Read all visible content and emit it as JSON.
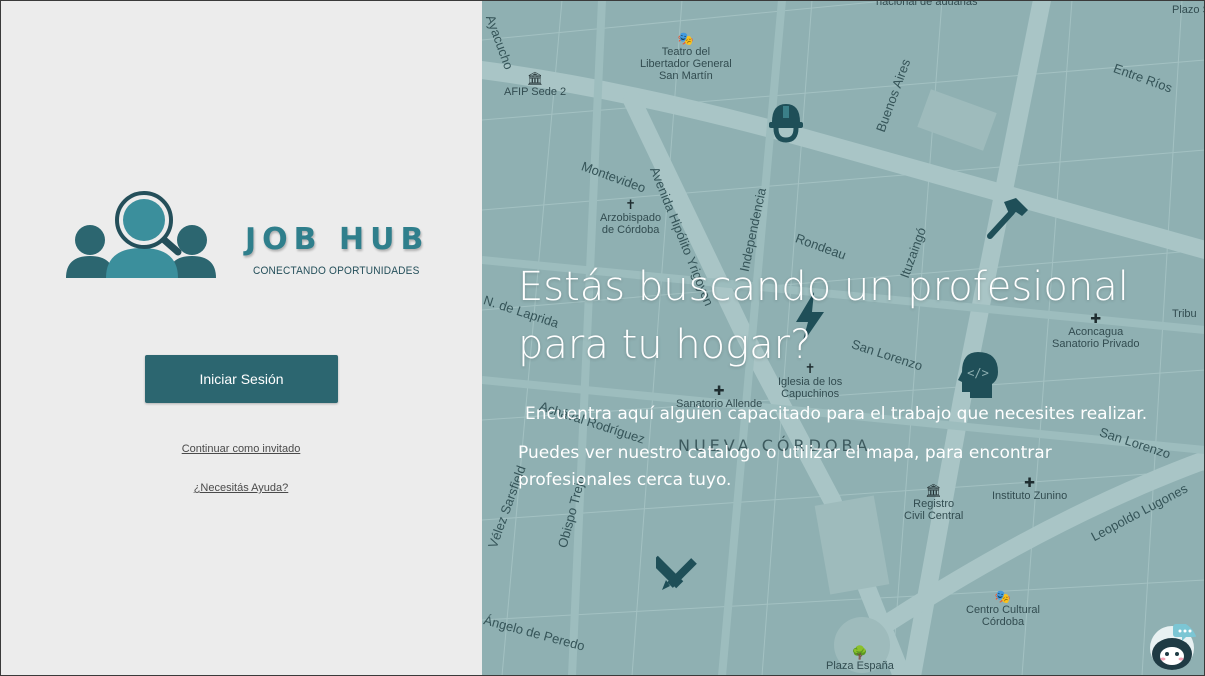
{
  "brand": {
    "title": "JOB HUB",
    "tagline": "CONECTANDO OPORTUNIDADES"
  },
  "auth": {
    "login_label": "Iniciar Sesión",
    "guest_label": "Continuar como invitado",
    "help_label": "¿Necesitás Ayuda?"
  },
  "hero": {
    "headline": "Estás buscando un profesional para tu hogar?",
    "line1": "Encuentra aquí alguien capacitado para el trabajo que necesites realizar.",
    "line2": "Puedes ver nuestro catalogo o utilizar el mapa, para encontrar profesionales cerca tuyo."
  },
  "map": {
    "streets": [
      "Ayacucho",
      "Montevideo",
      "Avenida Hipólito Yrigoyen",
      "Independencia",
      "Buenos Aires",
      "Entre Ríos",
      "Rondeau",
      "Ituzaingó",
      "San Lorenzo",
      "Obispo Trejo",
      "Achával Rodríguez",
      "Vélez Sarsfield",
      "Leopoldo Lugones",
      "Ángelo de Peredo",
      "N. de Laprida"
    ],
    "district": "NUEVA CÓRDOBA",
    "places": [
      {
        "name": "nacional de aduanas"
      },
      {
        "name": "Teatro del Libertador General San Martín",
        "l1": "Teatro del",
        "l2": "Libertador General",
        "l3": "San Martín"
      },
      {
        "name": "AFIP Sede 2"
      },
      {
        "name": "Arzobispado de Córdoba",
        "l1": "Arzobispado",
        "l2": "de Córdoba"
      },
      {
        "name": "Iglesia de los Capuchinos",
        "l1": "Iglesia de los",
        "l2": "Capuchinos"
      },
      {
        "name": "Sanatorio Allende"
      },
      {
        "name": "Aconcagua Sanatorio Privado",
        "l1": "Aconcagua",
        "l2": "Sanatorio Privado"
      },
      {
        "name": "Registro Civil Central",
        "l1": "Registro",
        "l2": "Civil Central"
      },
      {
        "name": "Instituto Zunino"
      },
      {
        "name": "Centro Cultural Córdoba",
        "l1": "Centro Cultural",
        "l2": "Córdoba"
      },
      {
        "name": "Plaza España"
      },
      {
        "name": "Plazo San Ro"
      },
      {
        "name": "Tribu"
      }
    ]
  },
  "colors": {
    "brand_teal": "#2f7f8c",
    "button": "#2c6670",
    "map_overlay": "#8fb0b2",
    "icon_dark": "#1f4f58"
  }
}
